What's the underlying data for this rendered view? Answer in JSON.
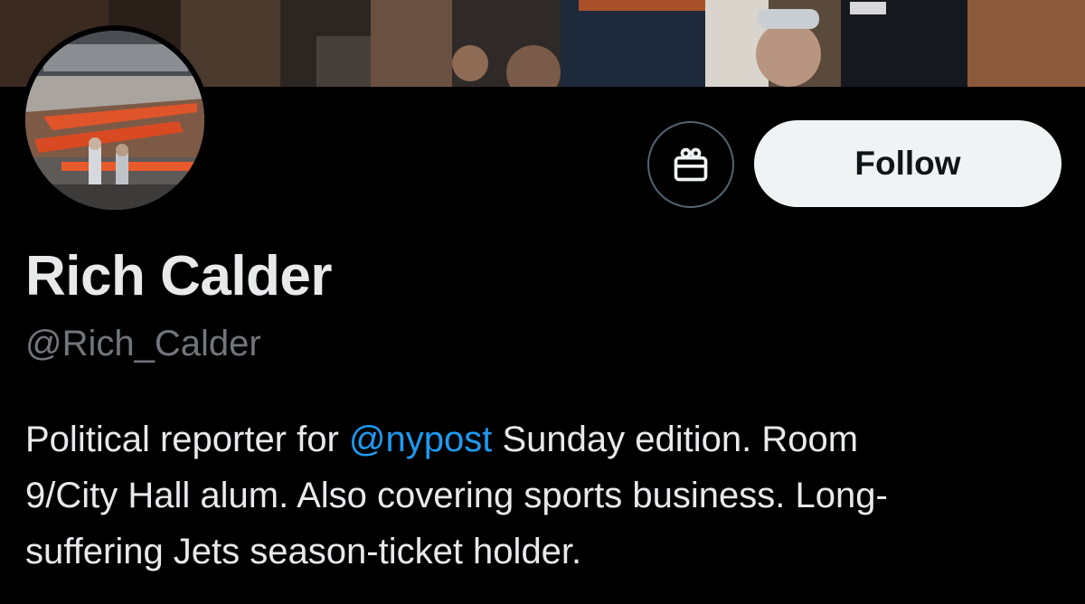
{
  "banner": {
    "description_icon": "header-photo"
  },
  "avatar": {
    "icon": "arena-photo"
  },
  "actions": {
    "gift_icon": "gift-icon",
    "follow_label": "Follow"
  },
  "profile": {
    "display_name": "Rich Calder",
    "handle": "@Rich_Calder",
    "bio": {
      "line1_before": "Political reporter for ",
      "mention": "@nypost",
      "line1_after": " Sunday edition. Room",
      "line2": "9/City Hall alum. Also covering sports business. Long-",
      "line3": "suffering Jets season-ticket holder."
    }
  },
  "colors": {
    "background": "#000000",
    "text_primary": "#e7e9ea",
    "text_secondary": "#71767b",
    "link": "#1d9bf0",
    "follow_bg": "#eff3f4"
  }
}
